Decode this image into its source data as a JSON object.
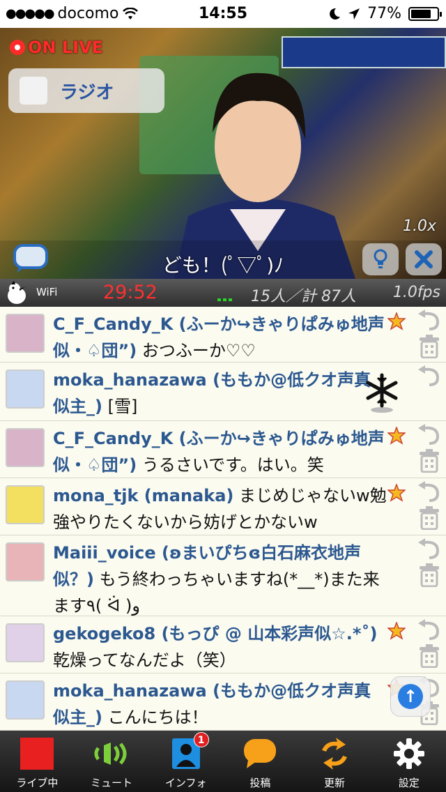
{
  "status_bar": {
    "signal": "●●●●●",
    "carrier": "docomo",
    "time": "14:55",
    "battery_percent": "77%",
    "battery_level": 0.77
  },
  "video": {
    "live_label": "ON LIVE",
    "radio_label": "ラジオ",
    "zoom_level": "1.0x",
    "current_comment": "ども！(ﾟ▽ﾟ)ﾉ"
  },
  "info_bar": {
    "network": "WiFi",
    "elapsed": "29:52",
    "viewers": "15人／計 87人",
    "fps": "1.0fps"
  },
  "comments": [
    {
      "username": "C_F_Candy_K (ふーか↪きゃりぱみゅ地声似・♤団”)",
      "text": "おつふーか♡♡",
      "starred": true,
      "avatar_color": "#d9b4c8"
    },
    {
      "username": "moka_hanazawa (ももか@低クオ声真似主_)",
      "text": "[雪]",
      "starred": false,
      "snow": true,
      "avatar_color": "#c8d8f0"
    },
    {
      "username": "C_F_Candy_K (ふーか↪きゃりぱみゅ地声似・♤団”)",
      "text": "うるさいです。はい。笑",
      "starred": true,
      "avatar_color": "#d9b4c8"
    },
    {
      "username": "mona_tjk (manaka)",
      "text": "まじめじゃないw勉強やりたくないから妨げとかないw",
      "starred": true,
      "avatar_color": "#f4e060"
    },
    {
      "username": "Maiii_voice (ʚまいぴちɞ白石麻衣地声似？)",
      "text": "もう終わっちゃいますね(*__*)また来ます٩( ᐛ )و",
      "starred": false,
      "avatar_color": "#e8b4b8"
    },
    {
      "username": "gekogeko8 (もっぴ @ 山本彩声似☆.*˚)",
      "text": "乾燥ってなんだよ（笑）",
      "starred": true,
      "avatar_color": "#e0d0e8"
    },
    {
      "username": "moka_hanazawa (ももか@低クオ声真似主_)",
      "text": "こんにちは！",
      "starred": true,
      "avatar_color": "#c8d8f0"
    }
  ],
  "tabs": [
    {
      "label": "ライブ中",
      "icon": "live-square-icon"
    },
    {
      "label": "ミュート",
      "icon": "mute-speaker-icon"
    },
    {
      "label": "インフォ",
      "icon": "info-person-icon",
      "badge": "1"
    },
    {
      "label": "投稿",
      "icon": "post-bubble-icon"
    },
    {
      "label": "更新",
      "icon": "refresh-icon"
    },
    {
      "label": "設定",
      "icon": "gear-icon"
    }
  ],
  "colors": {
    "username": "#2c5890",
    "timer": "#ff3030",
    "live_red": "#ff2a2a",
    "tabbar": "#1e1e1e",
    "accent_blue": "#1f63b6"
  }
}
